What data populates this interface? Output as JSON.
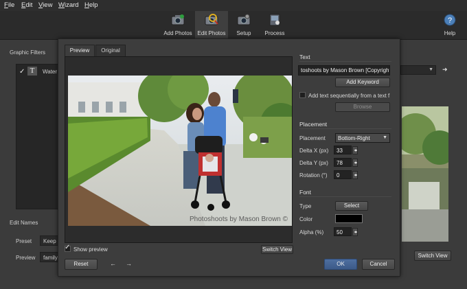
{
  "menu": [
    "File",
    "Edit",
    "View",
    "Wizard",
    "Help"
  ],
  "toolbar": [
    {
      "label": "Add Photos",
      "icon": "add-photos-icon"
    },
    {
      "label": "Edit Photos",
      "icon": "edit-photos-icon",
      "active": true
    },
    {
      "label": "Setup",
      "icon": "setup-icon"
    },
    {
      "label": "Process",
      "icon": "process-icon"
    }
  ],
  "help_label": "Help",
  "background": {
    "graphic_filters": "Graphic Filters",
    "filter_item": "Water",
    "edit_names": "Edit Names",
    "preset_label": "Preset",
    "preset_value": "Keep O",
    "preview_label": "Preview",
    "preview_value": "family",
    "switch_view": "Switch View"
  },
  "dialog": {
    "tabs": [
      "Preview",
      "Original"
    ],
    "watermark_text": "Photoshoots by Mason Brown ©",
    "show_preview": "Show preview",
    "switch_view": "Switch View",
    "reset": "Reset",
    "ok": "OK",
    "cancel": "Cancel",
    "text_section": {
      "title": "Text",
      "value": "toshoots by Mason Brown [Copyright]",
      "add_keyword": "Add Keyword",
      "sequential_label": "Add text sequentially from a text f",
      "browse": "Browse"
    },
    "placement_section": {
      "title": "Placement",
      "placement_label": "Placement",
      "placement_value": "Bottom-Right",
      "delta_x_label": "Delta X (px)",
      "delta_x": "33",
      "delta_y_label": "Delta Y (px)",
      "delta_y": "78",
      "rotation_label": "Rotation (°)",
      "rotation": "0"
    },
    "font_section": {
      "title": "Font",
      "type_label": "Type",
      "select": "Select",
      "color_label": "Color",
      "color_value": "#000000",
      "alpha_label": "Alpha (%)",
      "alpha": "50"
    }
  }
}
